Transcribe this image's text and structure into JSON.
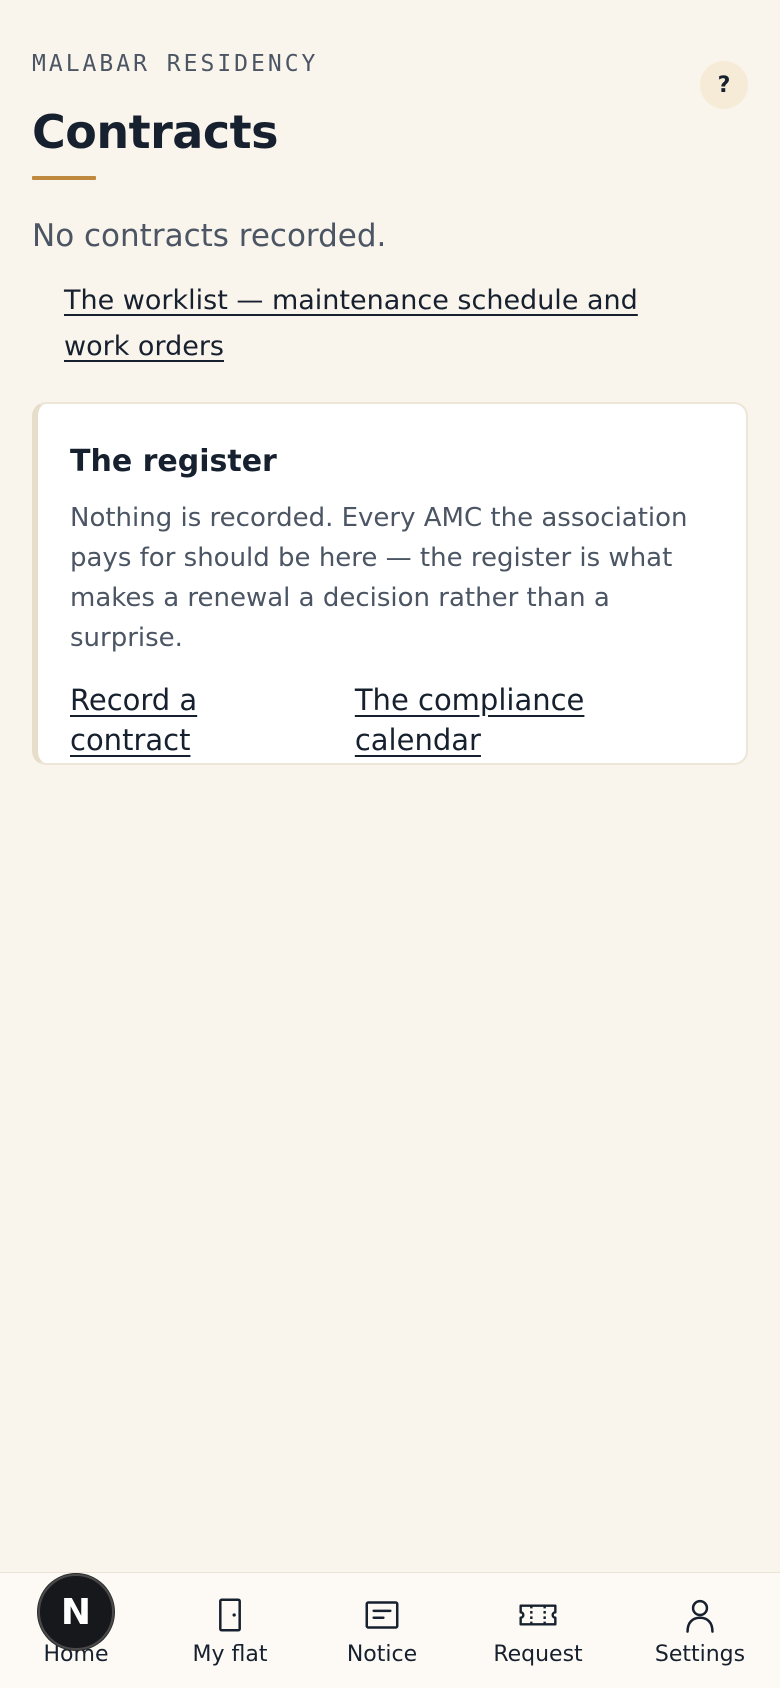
{
  "header": {
    "society_name": "MALABAR RESIDENCY",
    "title": "Contracts",
    "help_label": "?"
  },
  "main": {
    "empty_state": "No contracts recorded.",
    "worklist_link": "The worklist — maintenance schedule and work orders"
  },
  "register_card": {
    "title": "The register",
    "body": "Nothing is recorded. Every AMC the association pays for should be here — the register is what makes a renewal a decision rather than a surprise.",
    "actions": [
      {
        "label": "Record a contract"
      },
      {
        "label": "The compliance calendar"
      }
    ]
  },
  "bottom_nav": {
    "items": [
      {
        "label": "Home",
        "icon": "home-icon"
      },
      {
        "label": "My flat",
        "icon": "door-icon"
      },
      {
        "label": "Notice",
        "icon": "notice-icon"
      },
      {
        "label": "Request",
        "icon": "ticket-icon"
      },
      {
        "label": "Settings",
        "icon": "user-icon"
      }
    ],
    "home_badge_letter": "N"
  },
  "colors": {
    "background": "#f9f4ec",
    "accent": "#c08a3e",
    "text": "#16202e",
    "muted_text": "#4b5563",
    "card": "#ffffff"
  }
}
